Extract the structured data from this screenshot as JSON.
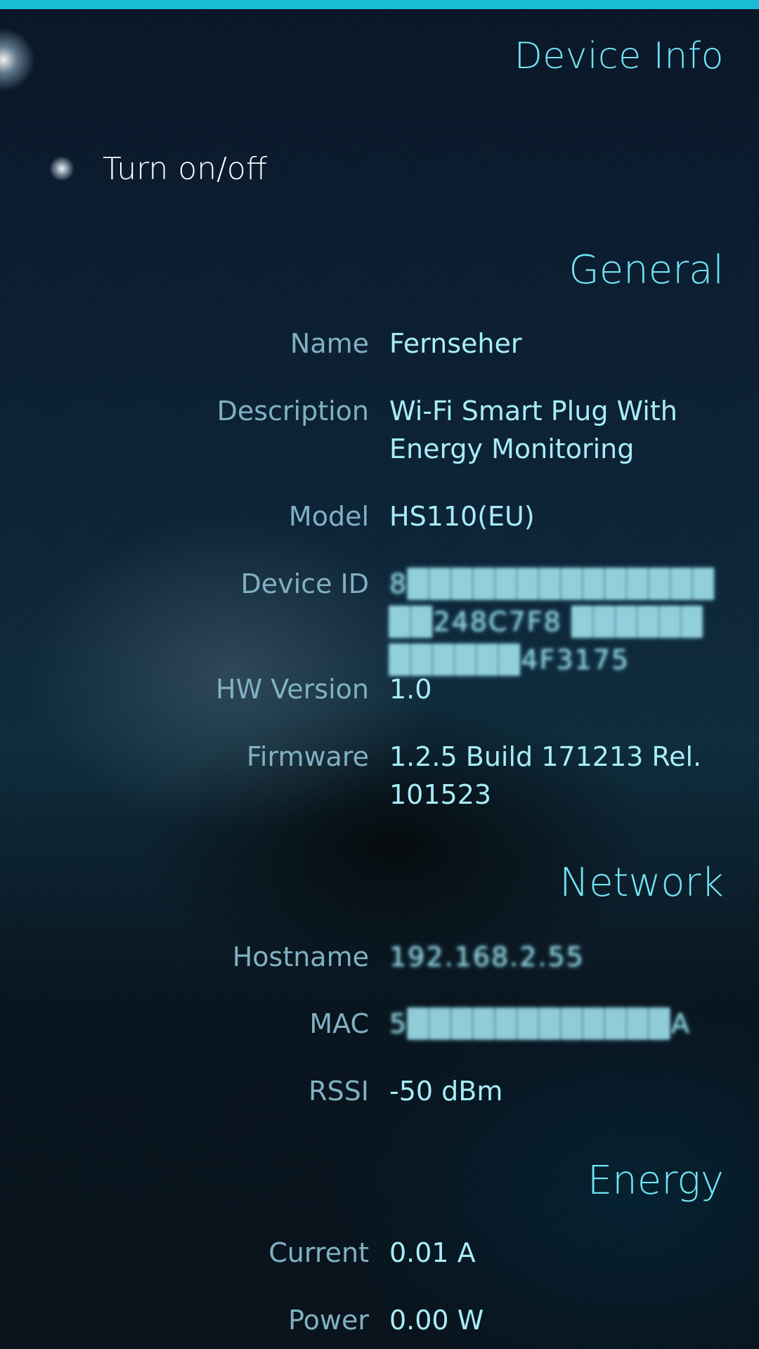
{
  "header": {
    "title": "Device Info"
  },
  "switch": {
    "label": "Turn on/off"
  },
  "sections": {
    "general": {
      "title": "General",
      "name_label": "Name",
      "name_value": "Fernseher",
      "description_label": "Description",
      "description_value": "Wi-Fi Smart Plug With Energy Monitoring",
      "model_label": "Model",
      "model_value": "HS110(EU)",
      "device_id_label": "Device ID",
      "device_id_value": "8████████████████248C7F8 ████████████4F3175",
      "hw_label": "HW Version",
      "hw_value": "1.0",
      "firmware_label": "Firmware",
      "firmware_value": "1.2.5 Build 171213 Rel. 101523"
    },
    "network": {
      "title": "Network",
      "hostname_label": "Hostname",
      "hostname_value": "192.168.2.55",
      "mac_label": "MAC",
      "mac_value": "5████████████A",
      "rssi_label": "RSSI",
      "rssi_value": "-50 dBm"
    },
    "energy": {
      "title": "Energy",
      "current_label": "Current",
      "current_value": "0.01 A",
      "power_label": "Power",
      "power_value": "0.00 W"
    }
  },
  "colors": {
    "accent": "#17bcd6",
    "title": "#6fe3f5",
    "label": "#7fb0c2",
    "value": "#a7ecf8"
  }
}
